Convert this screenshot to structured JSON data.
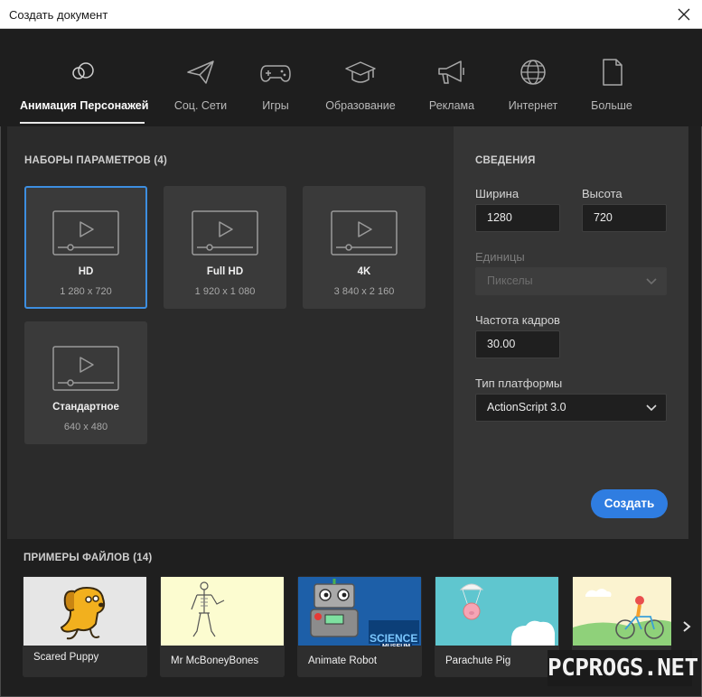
{
  "window": {
    "title": "Создать документ"
  },
  "tabs": [
    {
      "label": "Анимация Персонажей",
      "icon": "character-animation-icon",
      "active": true
    },
    {
      "label": "Соц. Сети",
      "icon": "paper-plane-icon"
    },
    {
      "label": "Игры",
      "icon": "gamepad-icon"
    },
    {
      "label": "Образование",
      "icon": "graduation-cap-icon"
    },
    {
      "label": "Реклама",
      "icon": "megaphone-icon"
    },
    {
      "label": "Интернет",
      "icon": "globe-icon"
    },
    {
      "label": "Больше",
      "icon": "document-icon"
    }
  ],
  "presets": {
    "heading": "НАБОРЫ ПАРАМЕТРОВ (4)",
    "items": [
      {
        "name": "HD",
        "size": "1 280 x 720",
        "selected": true
      },
      {
        "name": "Full HD",
        "size": "1 920 x 1 080"
      },
      {
        "name": "4K",
        "size": "3 840 x 2 160"
      },
      {
        "name": "Стандартное",
        "size": "640 x 480"
      }
    ]
  },
  "details": {
    "heading": "СВЕДЕНИЯ",
    "width_label": "Ширина",
    "width_value": "1280",
    "height_label": "Высота",
    "height_value": "720",
    "units_label": "Единицы",
    "units_value": "Пикселы",
    "fps_label": "Частота кадров",
    "fps_value": "30.00",
    "platform_label": "Тип платформы",
    "platform_value": "ActionScript 3.0",
    "create_label": "Создать"
  },
  "samples": {
    "heading": "ПРИМЕРЫ ФАЙЛОВ (14)",
    "items": [
      {
        "name": "Scared Puppy"
      },
      {
        "name": "Mr McBoneyBones"
      },
      {
        "name": "Animate Robot",
        "badge_line1": "SCIENCE",
        "badge_line2": "MUSEUM"
      },
      {
        "name": "Parachute Pig"
      },
      {
        "name": ""
      }
    ]
  },
  "watermark": "PCPROGS.NET",
  "colors": {
    "accent": "#2f7de1",
    "selected_border": "#3d8ee0",
    "panel": "#2b2b2b",
    "details_panel": "#353535"
  }
}
